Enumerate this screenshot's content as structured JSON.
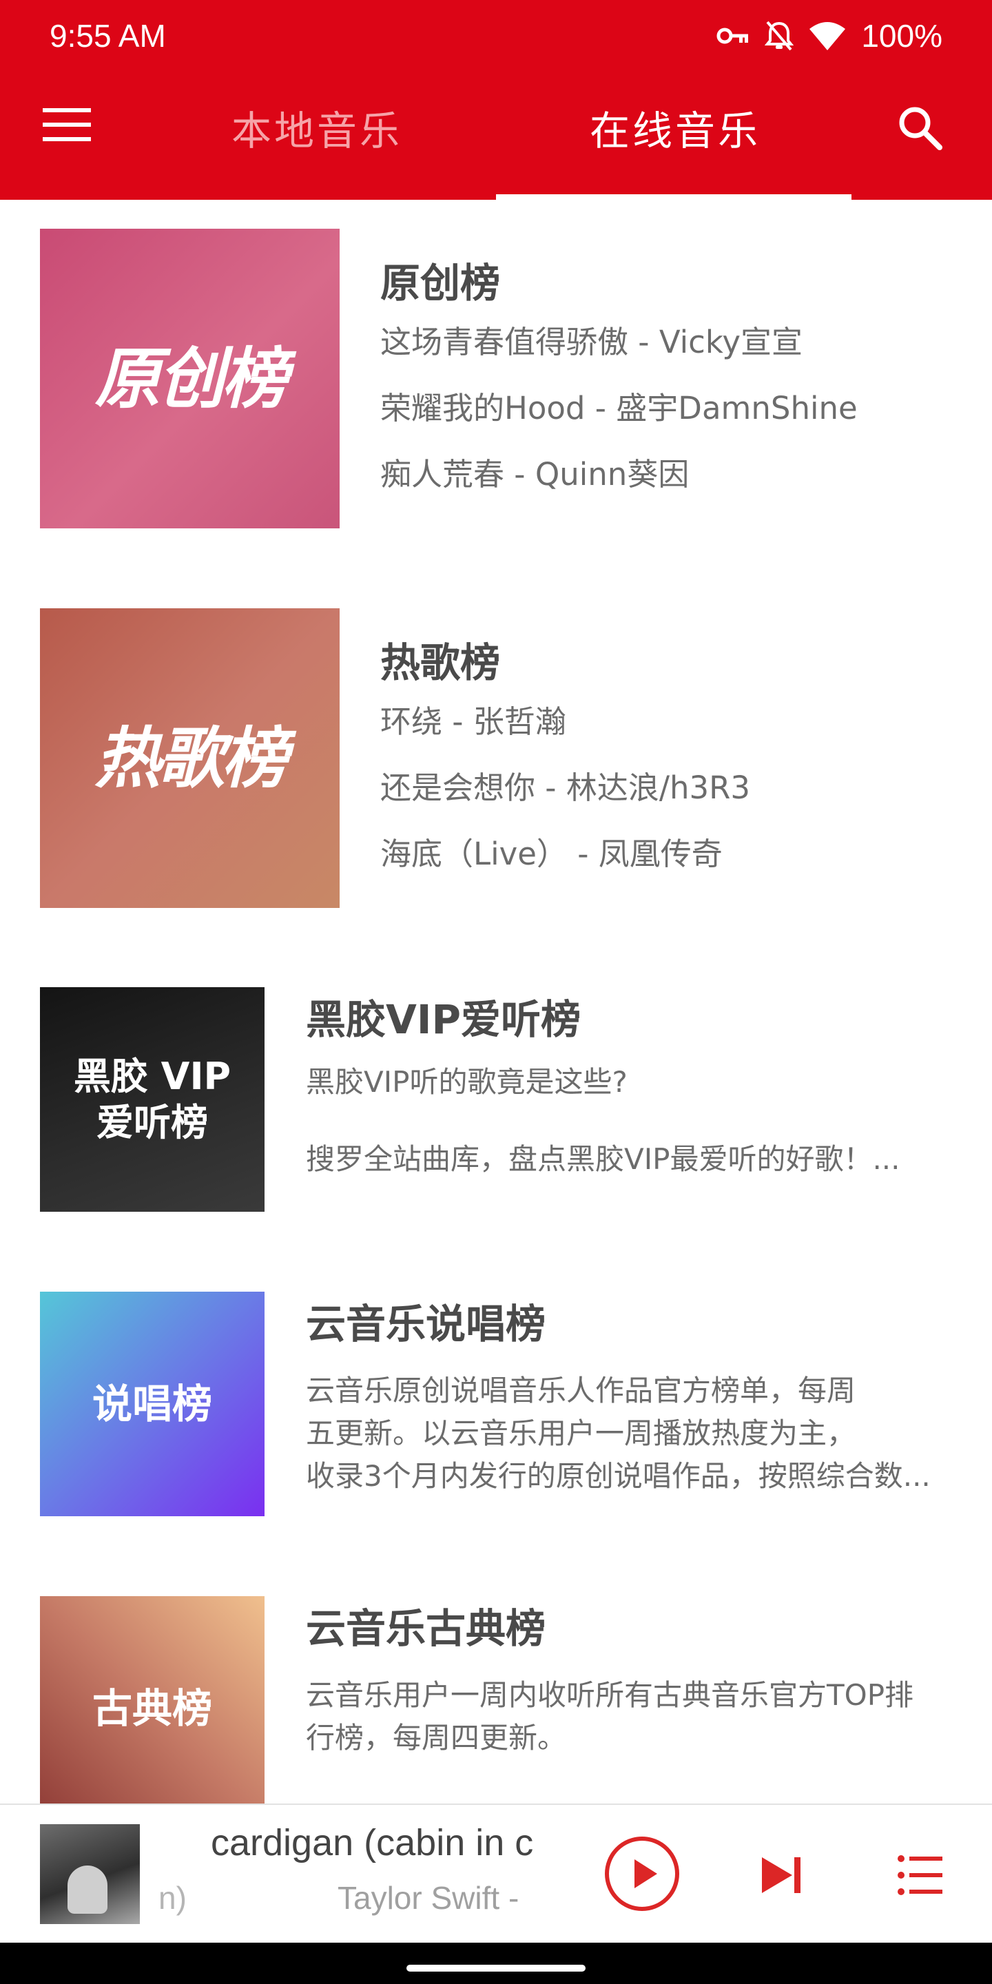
{
  "status_bar": {
    "time": "9:55 AM",
    "battery": "100%",
    "icons": [
      "vpn-key-icon",
      "bell-off-icon",
      "wifi-icon"
    ]
  },
  "header": {
    "tabs": [
      {
        "label": "本地音乐",
        "selected": false
      },
      {
        "label": "在线音乐",
        "selected": true
      }
    ],
    "menu_icon": "menu-icon",
    "search_icon": "search-icon"
  },
  "colors": {
    "brand_red": "#dc0516",
    "title_gray": "#4a4a4a",
    "text_gray": "#6c6c6c"
  },
  "charts": [
    {
      "name": "原创榜",
      "cover_text": "原创榜",
      "lines": [
        "这场青春值得骄傲 - Vicky宣宣",
        "荣耀我的Hood - 盛宇DamnShine",
        "痴人荒春 - Quinn葵因"
      ]
    },
    {
      "name": "热歌榜",
      "cover_text": "热歌榜",
      "lines": [
        "环绕 - 张哲瀚",
        "还是会想你 - 林达浪/h3R3",
        "海底（Live） - 凤凰传奇"
      ]
    },
    {
      "name": "黑胶VIP爱听榜",
      "cover_text_line1": "黑胶 VIP",
      "cover_text_line2": "爱听榜",
      "lines": [
        "黑胶VIP听的歌竟是这些?",
        "搜罗全站曲库，盘点黑胶VIP最爱听的好歌！..."
      ]
    },
    {
      "name": "云音乐说唱榜",
      "cover_text": "说唱榜",
      "lines": [
        "云音乐原创说唱音乐人作品官方榜单，每周",
        "五更新。以云音乐用户一周播放热度为主，",
        "收录3个月内发行的原创说唱作品，按照综合数..."
      ]
    },
    {
      "name": "云音乐古典榜",
      "cover_text": "古典榜",
      "lines": [
        "云音乐用户一周内收听所有古典音乐官方TOP排",
        "行榜，每周四更新。"
      ]
    }
  ],
  "player": {
    "song_title": "cardigan (cabin in c",
    "title_overflow": "n)",
    "artist": "Taylor Swift -",
    "play_icon": "play-icon",
    "next_icon": "skip-next-icon",
    "queue_icon": "playlist-icon"
  }
}
